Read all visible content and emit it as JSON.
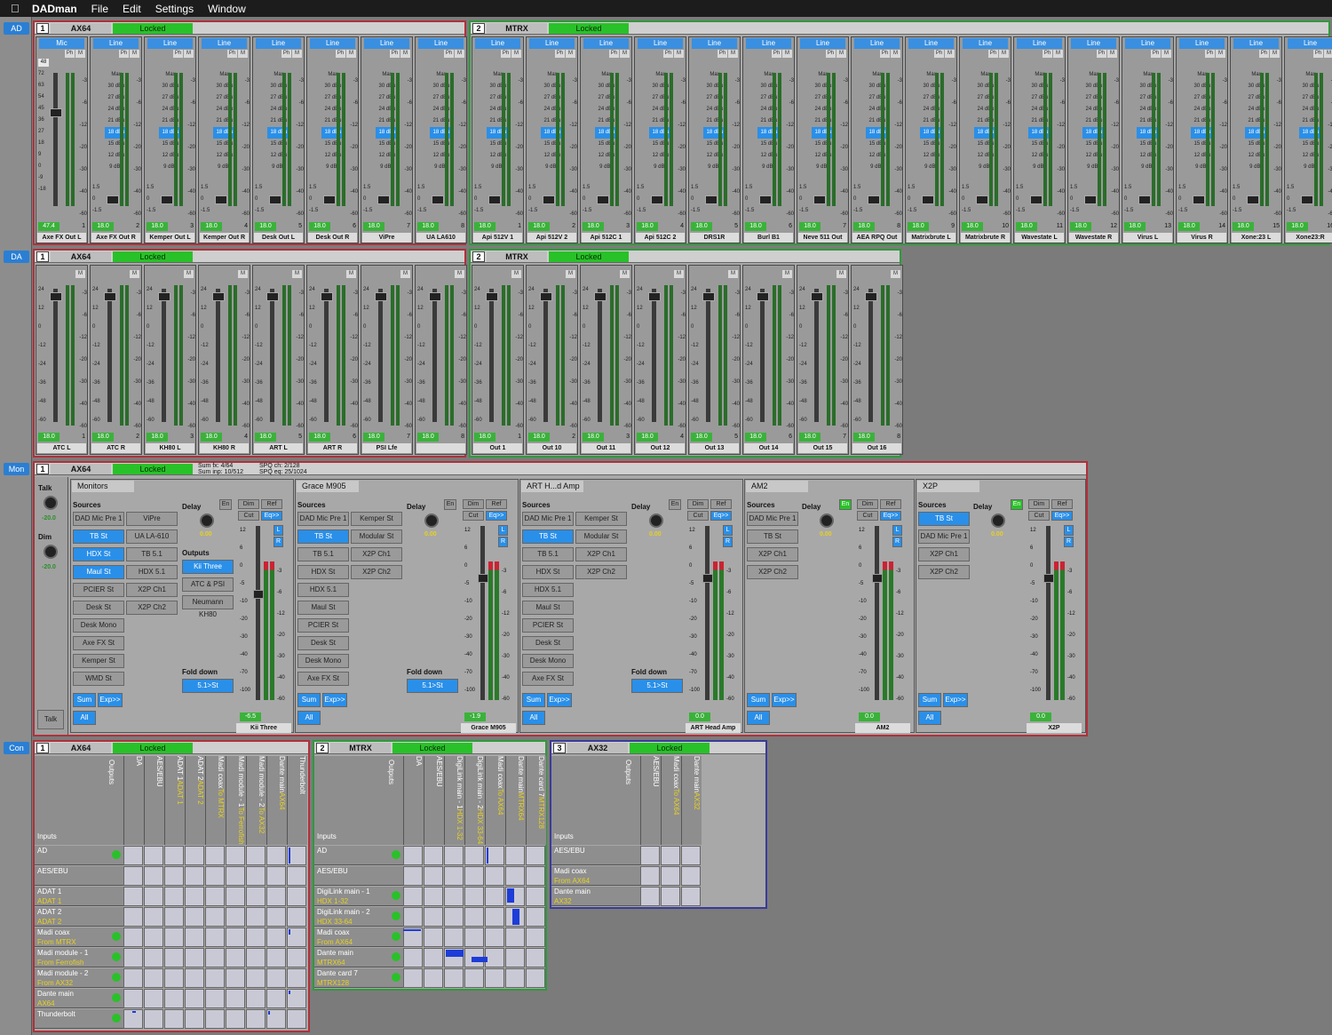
{
  "menu": {
    "app": "DADman",
    "file": "File",
    "edit": "Edit",
    "settings": "Settings",
    "window": "Window"
  },
  "side": {
    "ad": "AD",
    "da": "DA",
    "mon": "Mon",
    "con": "Con"
  },
  "ad": {
    "g1": {
      "num": "1",
      "title": "AX64",
      "locked": "Locked"
    },
    "g2": {
      "num": "2",
      "title": "MTRX",
      "locked": "Locked"
    },
    "scale_first": [
      "72",
      "63",
      "54",
      "45",
      "36",
      "27",
      "18",
      "9",
      "0",
      "-9",
      "-18"
    ],
    "levels": [
      "Max",
      "30 dBu",
      "27 dBu",
      "24 dBu",
      "21 dBu",
      "18 dBu",
      "15 dBu",
      "12 dBu",
      "9 dBu"
    ],
    "rscale": [
      "-3",
      "-6",
      "-12",
      "-20",
      "-30",
      "-40",
      "-60"
    ],
    "bscale": [
      "1.5",
      "0",
      "-1.5"
    ],
    "ph": "Ph",
    "m": "M",
    "gain": "48",
    "strips": [
      {
        "type": "Mic",
        "val": "47.4",
        "num": "1",
        "name": "Axe FX Out L"
      },
      {
        "type": "Line",
        "val": "18.0",
        "num": "2",
        "name": "Axe FX Out R"
      },
      {
        "type": "Line",
        "val": "18.0",
        "num": "3",
        "name": "Kemper Out L"
      },
      {
        "type": "Line",
        "val": "18.0",
        "num": "4",
        "name": "Kemper Out R"
      },
      {
        "type": "Line",
        "val": "18.0",
        "num": "5",
        "name": "Desk Out L"
      },
      {
        "type": "Line",
        "val": "18.0",
        "num": "6",
        "name": "Desk Out R"
      },
      {
        "type": "Line",
        "val": "18.0",
        "num": "7",
        "name": "ViPre"
      },
      {
        "type": "Line",
        "val": "18.0",
        "num": "8",
        "name": "UA LA610"
      },
      {
        "type": "Line",
        "val": "18.0",
        "num": "1",
        "name": "Api 512V 1"
      },
      {
        "type": "Line",
        "val": "18.0",
        "num": "2",
        "name": "Api 512V 2"
      },
      {
        "type": "Line",
        "val": "18.0",
        "num": "3",
        "name": "Api 512C 1"
      },
      {
        "type": "Line",
        "val": "18.0",
        "num": "4",
        "name": "Api 512C 2"
      },
      {
        "type": "Line",
        "val": "18.0",
        "num": "5",
        "name": "DRS1R"
      },
      {
        "type": "Line",
        "val": "18.0",
        "num": "6",
        "name": "Burl B1"
      },
      {
        "type": "Line",
        "val": "18.0",
        "num": "7",
        "name": "Neve 511 Out"
      },
      {
        "type": "Line",
        "val": "18.0",
        "num": "8",
        "name": "AEA RPQ Out"
      },
      {
        "type": "Line",
        "val": "18.0",
        "num": "9",
        "name": "Matrixbrute L"
      },
      {
        "type": "Line",
        "val": "18.0",
        "num": "10",
        "name": "Matrixbrute R"
      },
      {
        "type": "Line",
        "val": "18.0",
        "num": "11",
        "name": "Wavestate L"
      },
      {
        "type": "Line",
        "val": "18.0",
        "num": "12",
        "name": "Wavestate R"
      },
      {
        "type": "Line",
        "val": "18.0",
        "num": "13",
        "name": "Virus L"
      },
      {
        "type": "Line",
        "val": "18.0",
        "num": "14",
        "name": "Virus R"
      },
      {
        "type": "Line",
        "val": "18.0",
        "num": "15",
        "name": "Xone:23 L"
      },
      {
        "type": "Line",
        "val": "18.0",
        "num": "16",
        "name": "Xone23:R"
      }
    ]
  },
  "da": {
    "g1": {
      "num": "1",
      "title": "AX64",
      "locked": "Locked"
    },
    "g2": {
      "num": "2",
      "title": "MTRX",
      "locked": "Locked"
    },
    "scale": [
      "24",
      "12",
      "0",
      "-12",
      "-24",
      "-36",
      "-48",
      "-60"
    ],
    "rscale": [
      "-3",
      "-6",
      "-12",
      "-20",
      "-30",
      "-40",
      "-60"
    ],
    "strips": [
      {
        "val": "18.0",
        "num": "1",
        "name": "ATC L"
      },
      {
        "val": "18.0",
        "num": "2",
        "name": "ATC R"
      },
      {
        "val": "18.0",
        "num": "3",
        "name": "KH80 L"
      },
      {
        "val": "18.0",
        "num": "4",
        "name": "KH80 R"
      },
      {
        "val": "18.0",
        "num": "5",
        "name": "ART L"
      },
      {
        "val": "18.0",
        "num": "6",
        "name": "ART R"
      },
      {
        "val": "18.0",
        "num": "7",
        "name": "PSI Lfe"
      },
      {
        "val": "18.0",
        "num": "8",
        "name": ""
      },
      {
        "val": "18.0",
        "num": "1",
        "name": "Out 1"
      },
      {
        "val": "18.0",
        "num": "2",
        "name": "Out 10"
      },
      {
        "val": "18.0",
        "num": "3",
        "name": "Out 11"
      },
      {
        "val": "18.0",
        "num": "4",
        "name": "Out 12"
      },
      {
        "val": "18.0",
        "num": "5",
        "name": "Out 13"
      },
      {
        "val": "18.0",
        "num": "6",
        "name": "Out 14"
      },
      {
        "val": "18.0",
        "num": "7",
        "name": "Out 15"
      },
      {
        "val": "18.0",
        "num": "8",
        "name": "Out 16"
      }
    ]
  },
  "mon": {
    "num": "1",
    "title": "AX64",
    "locked": "Locked",
    "sum_fx": "Sum fx: 4/64",
    "sum_inp": "Sum inp: 10/512",
    "spq_ch": "SPQ ch: 2/128",
    "spq_eq": "SPQ eq: 25/1024",
    "talk": "Talk",
    "talk_val": "-20.0",
    "dim": "Dim",
    "dim_val": "-20.0",
    "talk_btn": "Talk",
    "labels": {
      "sources": "Sources",
      "delay": "Delay",
      "en": "En",
      "dim": "Dim",
      "ref": "Ref",
      "cut": "Cut",
      "eq": "Eq>>",
      "outputs": "Outputs",
      "folddown": "Fold down",
      "fold_val": "5.1>St",
      "sum": "Sum",
      "exp": "Exp>>",
      "all": "All",
      "delay_val": "0.00",
      "l": "L",
      "r": "R"
    },
    "mscale": [
      "12",
      "6",
      "0",
      "-5",
      "-10",
      "-20",
      "-30",
      "-40",
      "-70",
      "-100"
    ],
    "rscale": [
      "-3",
      "-6",
      "-12",
      "-20",
      "-30",
      "-40",
      "-60"
    ],
    "sections": [
      {
        "title": "Monitors",
        "val": "-6.5",
        "name": "Kii Three",
        "col1": [
          "DAD Mic Pre 1",
          "TB St",
          "HDX St",
          "Maul St",
          "PCIER St",
          "Desk St",
          "Desk Mono",
          "Axe FX St",
          "Kemper St",
          "WMD St"
        ],
        "col2": [
          "ViPre",
          "UA LA-610",
          "TB 5.1",
          "HDX 5.1",
          "X2P Ch1",
          "X2P Ch2"
        ],
        "outs": [
          "Kii Three",
          "ATC & PSI",
          "Neumann KH80"
        ]
      },
      {
        "title": "Grace M905",
        "val": "-1.9",
        "name": "Grace M905",
        "col1": [
          "DAD Mic Pre 1",
          "TB St",
          "TB 5.1",
          "HDX St",
          "HDX 5.1",
          "Maul St",
          "PCIER St",
          "Desk St",
          "Desk Mono",
          "Axe FX St"
        ],
        "col2": [
          "Kemper St",
          "Modular St",
          "X2P Ch1",
          "X2P Ch2"
        ]
      },
      {
        "title": "ART H...d Amp",
        "val": "0.0",
        "name": "ART Head Amp",
        "col1": [
          "DAD Mic Pre 1",
          "TB St",
          "TB 5.1",
          "HDX St",
          "HDX 5.1",
          "Maul St",
          "PCIER St",
          "Desk St",
          "Desk Mono",
          "Axe FX St"
        ],
        "col2": [
          "Kemper St",
          "Modular St",
          "X2P Ch1",
          "X2P Ch2"
        ]
      },
      {
        "title": "AM2",
        "val": "0.0",
        "name": "AM2",
        "col1": [
          "DAD Mic Pre 1",
          "TB St",
          "X2P Ch1",
          "X2P Ch2"
        ]
      },
      {
        "title": "X2P",
        "val": "0.0",
        "name": "X2P",
        "col1": [
          "TB St",
          "DAD Mic Pre 1",
          "X2P Ch1",
          "X2P Ch2"
        ]
      }
    ]
  },
  "con": {
    "outputs": "Outputs",
    "inputs": "Inputs",
    "m1": {
      "num": "1",
      "title": "AX64",
      "locked": "Locked",
      "cols": [
        [
          "DA",
          ""
        ],
        [
          "AES/EBU",
          ""
        ],
        [
          "ADAT 1",
          "ADAT 1"
        ],
        [
          "ADAT 2",
          "ADAT 2"
        ],
        [
          "Madi coax",
          "To MTRX"
        ],
        [
          "Madi module - 1",
          "To Ferrofish"
        ],
        [
          "Madi module - 2",
          "To AX32"
        ],
        [
          "Dante main",
          "AX64"
        ],
        [
          "Thunderbolt",
          ""
        ]
      ],
      "rows": [
        [
          "AD",
          ""
        ],
        [
          "AES/EBU",
          ""
        ],
        [
          "ADAT 1",
          "ADAT 1"
        ],
        [
          "ADAT 2",
          "ADAT 2"
        ],
        [
          "Madi coax",
          "From MTRX"
        ],
        [
          "Madi module - 1",
          "From Ferrofish"
        ],
        [
          "Madi module - 2",
          "From AX32"
        ],
        [
          "Dante main",
          "AX64"
        ],
        [
          "Thunderbolt",
          ""
        ]
      ]
    },
    "m2": {
      "num": "2",
      "title": "MTRX",
      "locked": "Locked",
      "cols": [
        [
          "DA",
          ""
        ],
        [
          "AES/EBU",
          ""
        ],
        [
          "DigiLink main - 1",
          "HDX 1-32"
        ],
        [
          "DigiLink main - 2",
          "HDX 33-64"
        ],
        [
          "Madi coax",
          "To AX64"
        ],
        [
          "Dante main",
          "MTRX64"
        ],
        [
          "Dante card 7",
          "MTRX128"
        ]
      ],
      "rows": [
        [
          "AD",
          ""
        ],
        [
          "AES/EBU",
          ""
        ],
        [
          "DigiLink main - 1",
          "HDX 1-32"
        ],
        [
          "DigiLink main - 2",
          "HDX 33-64"
        ],
        [
          "Madi coax",
          "From AX64"
        ],
        [
          "Dante main",
          "MTRX64"
        ],
        [
          "Dante card 7",
          "MTRX128"
        ]
      ]
    },
    "m3": {
      "num": "3",
      "title": "AX32",
      "locked": "Locked",
      "cols": [
        [
          "AES/EBU",
          ""
        ],
        [
          "Madi coax",
          "To AX64"
        ],
        [
          "Dante main",
          "AX32"
        ]
      ],
      "rows": [
        [
          "AES/EBU",
          ""
        ],
        [
          "Madi coax",
          "From AX64"
        ],
        [
          "Dante main",
          "AX32"
        ]
      ]
    }
  }
}
